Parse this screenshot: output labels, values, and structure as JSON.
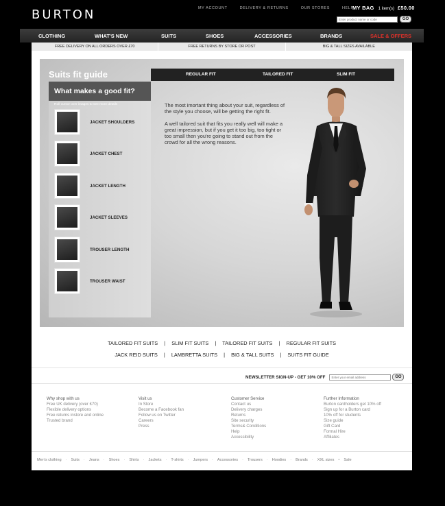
{
  "header": {
    "logo": "BURTON",
    "top_links": [
      "MY ACCOUNT",
      "DELIVERY & RETURNS",
      "OUR STORES",
      "HELP"
    ],
    "bag_label": "MY BAG",
    "bag_items": "1 item(s)",
    "bag_total": "£50.00",
    "search_placeholder": "Enter product name or code",
    "go_label": "GO"
  },
  "nav": {
    "items": [
      "CLOTHING",
      "WHAT'S NEW",
      "SUITS",
      "SHOES",
      "ACCESSORIES",
      "BRANDS",
      "SALE & OFFERS"
    ],
    "sale_color": "#e8312a"
  },
  "promo": [
    "FREE DELIVERY ON ALL ORDERS OVER £70",
    "FREE RETURNS BY STORE OR POST",
    "BIG & TALL SIZES AVAILABLE"
  ],
  "fit_guide": {
    "title": "Suits fit guide",
    "tabs": [
      "REGULAR FIT",
      "TAILORED FIT",
      "SLIM FIT"
    ],
    "sidebar_title": "What makes a good fit?",
    "sidebar_hint": "Roll cursor over images to see more details",
    "items": [
      "JACKET SHOULDERS",
      "JACKET CHEST",
      "JACKET LENGTH",
      "JACKET SLEEVES",
      "TROUSER LENGTH",
      "TROUSER WAIST"
    ],
    "copy_1": "The most imortant thing about your suit, regardless of the style you choose, will be getting the right fit.",
    "copy_2": "A well tailored suit that fits you really well will make a great impression, but if you get it too big, too tight or too small then you're going to stand out from the crowd for all the wrong reasons."
  },
  "suit_links": {
    "row1": [
      "TAILORED FIT SUITS",
      "SLIM FIT SUITS",
      "TAILORED FIT SUITS",
      "REGULAR FIT SUITS"
    ],
    "row2": [
      "JACK REID SUITS",
      "LAMBRETTA SUITS",
      "BIG & TALL SUITS",
      "SUITS FIT GUIDE"
    ],
    "separator": "|"
  },
  "newsletter": {
    "label": "NEWSLETTER SIGN-UP - GET 10% OFF",
    "placeholder": "Enter your email address",
    "go_label": "GO"
  },
  "footer": {
    "col1": {
      "heading": "Why shop with us",
      "items": [
        "Free UK delivery (over £70)",
        "Flexible delivery options",
        "Free returns instore and online",
        "Trusted brand"
      ]
    },
    "col2": {
      "heading": "Visit us",
      "items": [
        "In Store",
        "Become a Facebook fan",
        "Follow us on Twitter",
        "Careers",
        "Press"
      ]
    },
    "col3": {
      "heading": "Customer Service",
      "items": [
        "Contact us",
        "Delivery charges",
        "Returns",
        "Site security",
        "Terms& Conditions",
        "Help",
        "Accessibility"
      ]
    },
    "col4": {
      "heading": "Further Information",
      "items": [
        "Burton cardholders get 10% off",
        "Sign up for a Burton card",
        "10% off for students",
        "Size guide",
        "Gift Card",
        "Formal Hire",
        "Affiliates"
      ]
    }
  },
  "bottom_links": [
    "Men's clothing",
    "Suits",
    "Jeans",
    "Shoes",
    "Shirts",
    "Jackets",
    "T-shirts",
    "Jumpers",
    "Accessories",
    "Trousers",
    "Hoodies",
    "Brands",
    "XXL sizes",
    "Sale"
  ]
}
